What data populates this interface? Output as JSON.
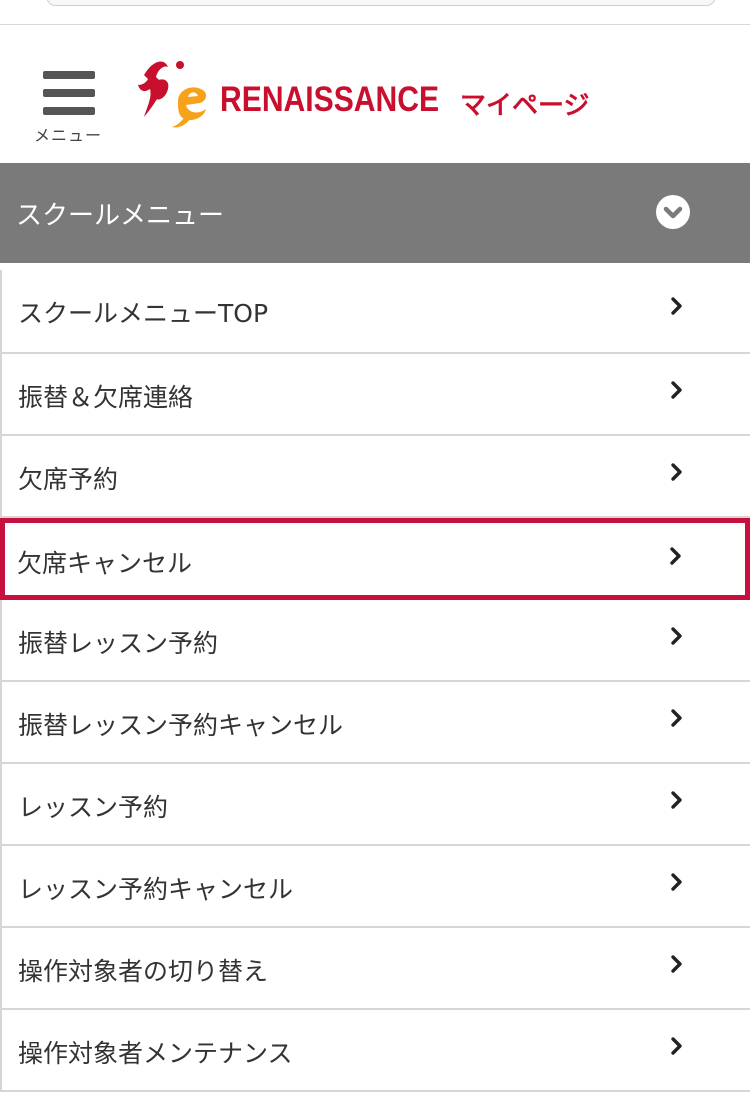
{
  "header": {
    "menu_label": "メニュー",
    "logo_text": "RENAISSANCE",
    "mypage_label": "マイページ"
  },
  "school_menu": {
    "title": "スクールメニュー",
    "expanded": true
  },
  "menu_items": [
    {
      "label": "スクールメニューTOP"
    },
    {
      "label": "振替＆欠席連絡"
    },
    {
      "label": "欠席予約"
    },
    {
      "label": "欠席キャンセル",
      "highlighted": true
    },
    {
      "label": "振替レッスン予約"
    },
    {
      "label": "振替レッスン予約キャンセル"
    },
    {
      "label": "レッスン予約"
    },
    {
      "label": "レッスン予約キャンセル"
    },
    {
      "label": "操作対象者の切り替え"
    },
    {
      "label": "操作対象者メンテナンス"
    }
  ],
  "colors": {
    "brand_red": "#c8102e",
    "highlight_border": "#c8103f",
    "menu_bar_gray": "#7a7a7a",
    "logo_orange": "#f7a21b"
  }
}
